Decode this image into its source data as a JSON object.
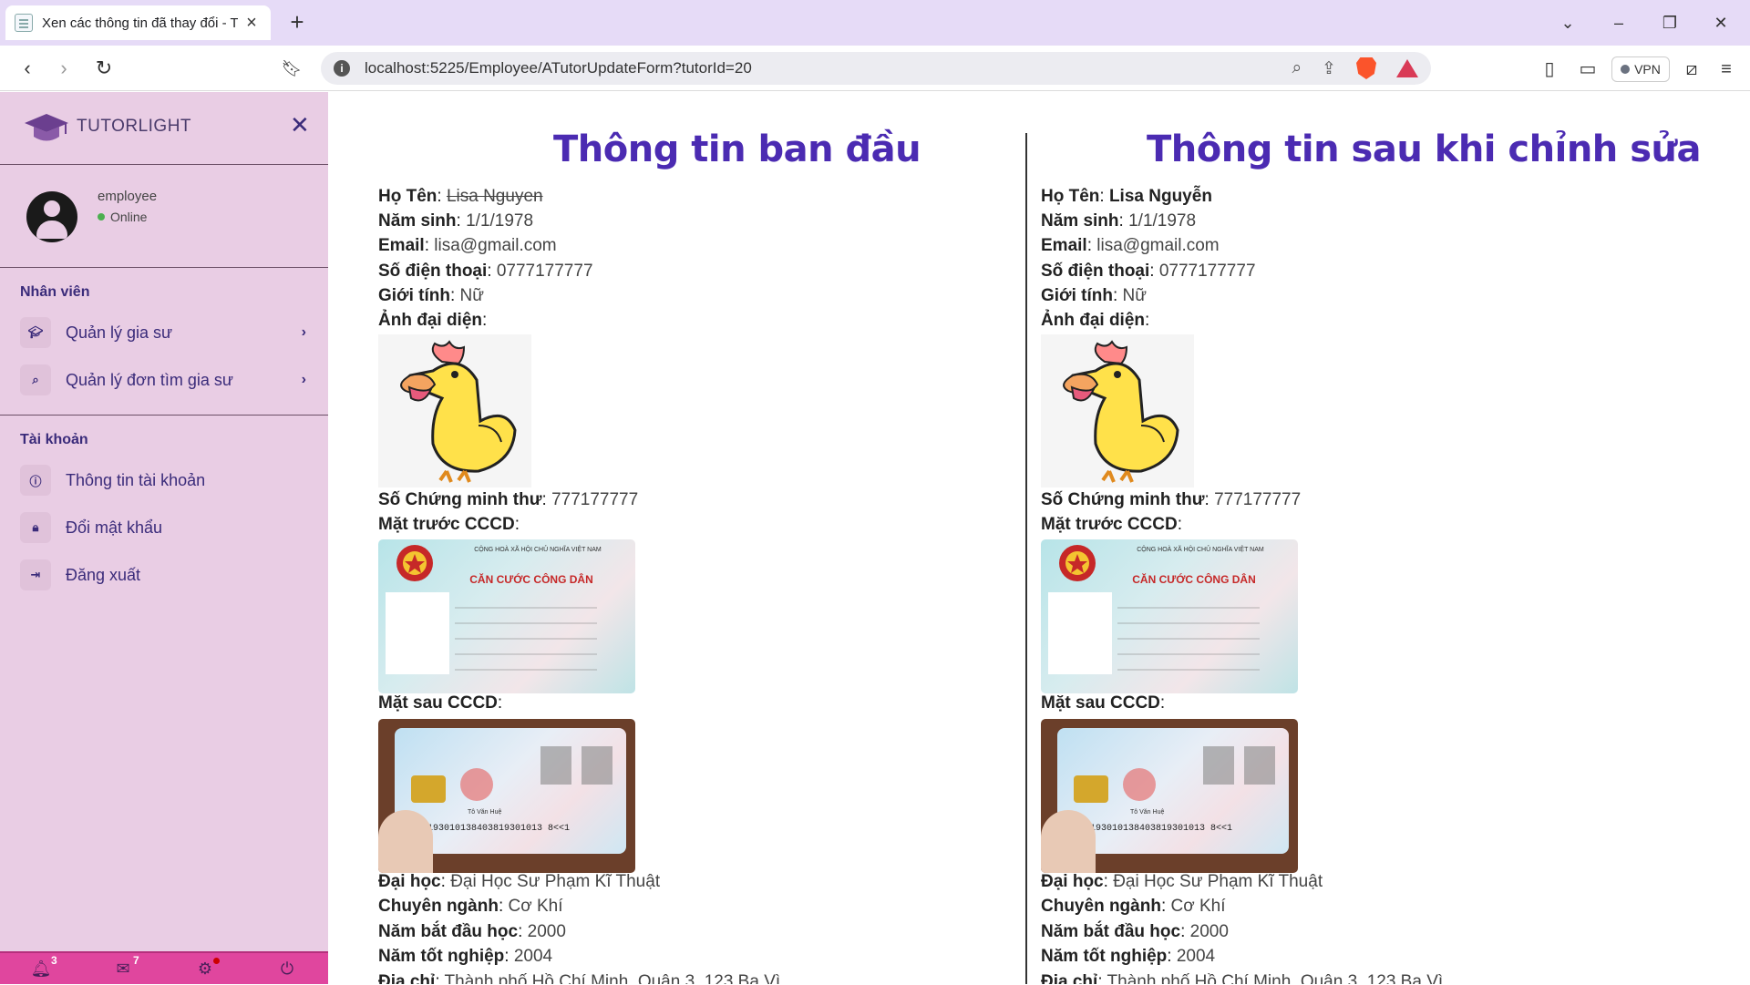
{
  "browser": {
    "tab_title": "Xen các thông tin đã thay đổi - T",
    "url": "localhost:5225/Employee/ATutorUpdateForm?tutorId=20",
    "vpn_label": "VPN"
  },
  "sidebar": {
    "brand": "TUTORLIGHT",
    "user": {
      "role": "employee",
      "status": "Online"
    },
    "sections": [
      {
        "label": "Nhân viên",
        "items": [
          {
            "label": "Quản lý gia sư",
            "icon": "graduation-cap-icon"
          },
          {
            "label": "Quản lý đơn tìm gia sư",
            "icon": "search-icon"
          }
        ]
      },
      {
        "label": "Tài khoản",
        "items": [
          {
            "label": "Thông tin tài khoản",
            "icon": "info-icon"
          },
          {
            "label": "Đổi mật khẩu",
            "icon": "lock-icon"
          },
          {
            "label": "Đăng xuất",
            "icon": "logout-icon"
          }
        ]
      }
    ],
    "footer": {
      "notifications_count": "3",
      "messages_count": "7"
    }
  },
  "labels": {
    "name": "Họ Tên",
    "birth_year": "Năm sinh",
    "email": "Email",
    "phone": "Số điện thoại",
    "gender": "Giới tính",
    "avatar": "Ảnh đại diện",
    "id_number": "Số Chứng minh thư",
    "id_front": "Mặt trước CCCD",
    "id_back": "Mặt sau CCCD",
    "university": "Đại học",
    "major": "Chuyên ngành",
    "start_year": "Năm bắt đầu học",
    "grad_year": "Năm tốt nghiệp",
    "address": "Địa chỉ"
  },
  "original": {
    "title": "Thông tin ban đầu",
    "name": "Lisa Nguyen",
    "birth_year": "1/1/1978",
    "email": "lisa@gmail.com",
    "phone": "0777177777",
    "gender": "Nữ",
    "id_number": "777177777",
    "university": "Đại Học Sư Phạm Kĩ Thuật",
    "major": "Cơ Khí",
    "start_year": "2000",
    "grad_year": "2004",
    "address": "Thành phố Hồ Chí Minh, Quận 3, 123 Ba Vì"
  },
  "updated": {
    "title": "Thông tin sau khi chỉnh sửa",
    "name": "Lisa Nguyễn",
    "birth_year": "1/1/1978",
    "email": "lisa@gmail.com",
    "phone": "0777177777",
    "gender": "Nữ",
    "id_number": "777177777",
    "university": "Đại Học Sư Phạm Kĩ Thuật",
    "major": "Cơ Khí",
    "start_year": "2000",
    "grad_year": "2004",
    "address": "Thành phố Hồ Chí Minh, Quận 3, 123 Ba Vì"
  },
  "card_front_text": {
    "header": "CỘNG HOÀ XÃ HỘI CHỦ NGHĨA VIỆT NAM",
    "title": "CĂN CƯỚC CÔNG DÂN"
  },
  "card_back_text": {
    "mrz": "IDVNM193010138403819301013 8<<1",
    "holder": "Tô Văn Huệ"
  },
  "colors": {
    "accent": "#4b2bb2",
    "sidebar_bg": "#e9cde4",
    "footer_bg": "#e0469e"
  }
}
